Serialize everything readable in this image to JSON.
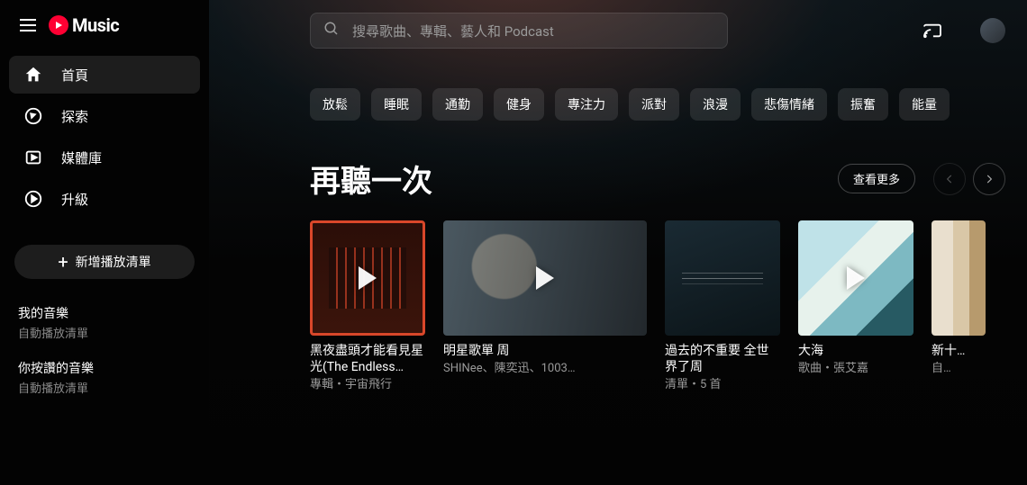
{
  "brand": {
    "name": "Music"
  },
  "sidebar": {
    "items": [
      {
        "label": "首頁"
      },
      {
        "label": "探索"
      },
      {
        "label": "媒體庫"
      },
      {
        "label": "升級"
      }
    ],
    "new_playlist_label": "新增播放清單",
    "library": [
      {
        "title": "我的音樂",
        "subtitle": "自動播放清單"
      },
      {
        "title": "你按讚的音樂",
        "subtitle": "自動播放清單"
      }
    ]
  },
  "search": {
    "placeholder": "搜尋歌曲、專輯、藝人和 Podcast"
  },
  "chips": [
    "放鬆",
    "睡眠",
    "通勤",
    "健身",
    "專注力",
    "派對",
    "浪漫",
    "悲傷情緒",
    "振奮",
    "能量"
  ],
  "section": {
    "title": "再聽一次",
    "more_label": "查看更多"
  },
  "cards": [
    {
      "title": "黑夜盡頭才能看見星光(The Endless…",
      "subtitle": "專輯・宇宙飛行",
      "wide": false
    },
    {
      "title": "明星歌單 周",
      "subtitle": "SHINee、陳奕迅、1003…",
      "wide": true
    },
    {
      "title": "過去的不重要 全世界了周",
      "subtitle": "清單・5 首",
      "wide": false
    },
    {
      "title": "大海",
      "subtitle": "歌曲・張艾嘉",
      "wide": false
    },
    {
      "title": "新十…",
      "subtitle": "自…",
      "wide": false
    }
  ]
}
